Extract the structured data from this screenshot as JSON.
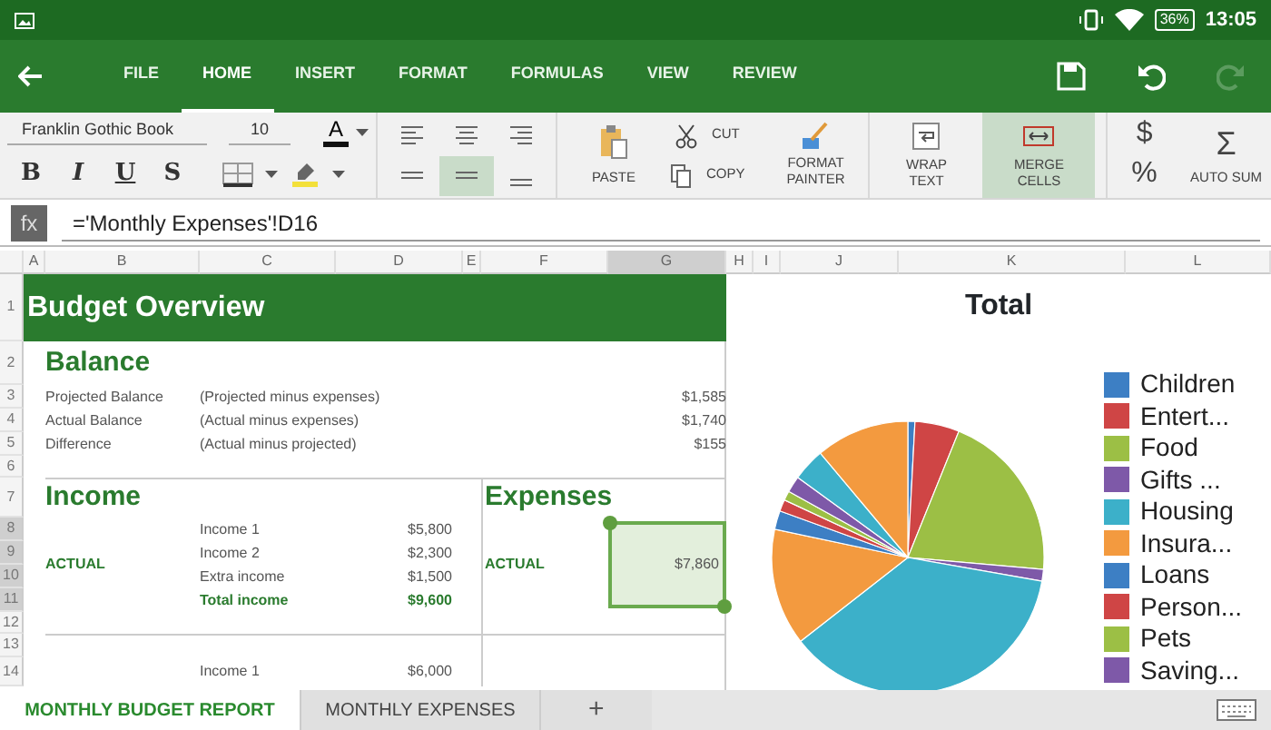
{
  "status_bar": {
    "battery": "36%",
    "time": "13:05"
  },
  "toolbar": {
    "tabs": [
      {
        "label": "FILE",
        "selected": false
      },
      {
        "label": "HOME",
        "selected": true
      },
      {
        "label": "INSERT",
        "selected": false
      },
      {
        "label": "FORMAT",
        "selected": false
      },
      {
        "label": "FORMULAS",
        "selected": false
      },
      {
        "label": "VIEW",
        "selected": false
      },
      {
        "label": "REVIEW",
        "selected": false
      }
    ],
    "redo_disabled": true
  },
  "ribbon": {
    "font_name": "Franklin Gothic Book",
    "font_size": "10",
    "font_color_letter": "A",
    "styles": [
      "B",
      "I",
      "U",
      "S"
    ],
    "alignments": [
      {
        "kind": "top-left",
        "selected": false
      },
      {
        "kind": "top-center",
        "selected": false
      },
      {
        "kind": "top-right",
        "selected": false
      },
      {
        "kind": "middle-left",
        "selected": false
      },
      {
        "kind": "middle-center",
        "selected": true
      },
      {
        "kind": "bottom",
        "selected": false
      }
    ],
    "paste": "PASTE",
    "cut": "CUT",
    "copy": "COPY",
    "format_painter": "FORMAT PAINTER",
    "wrap_text": {
      "label": "WRAP TEXT",
      "selected": false
    },
    "merge_cells": {
      "label": "MERGE CELLS",
      "selected": true
    },
    "currency": "$",
    "percent": "%",
    "auto_sum": {
      "symbol": "Σ",
      "label": "AUTO SUM"
    }
  },
  "formula_bar": {
    "label": "fx",
    "value": "='Monthly Expenses'!D16"
  },
  "sheet": {
    "columns": [
      {
        "label": "A",
        "selected": false
      },
      {
        "label": "B",
        "selected": false
      },
      {
        "label": "C",
        "selected": false
      },
      {
        "label": "D",
        "selected": false
      },
      {
        "label": "E",
        "selected": false
      },
      {
        "label": "F",
        "selected": false
      },
      {
        "label": "G",
        "selected": true
      },
      {
        "label": "H",
        "selected": false
      },
      {
        "label": "I",
        "selected": false
      },
      {
        "label": "J",
        "selected": false
      },
      {
        "label": "K",
        "selected": false
      },
      {
        "label": "L",
        "selected": false
      }
    ],
    "rows": [
      {
        "label": "1",
        "selected": false
      },
      {
        "label": "2",
        "selected": false
      },
      {
        "label": "3",
        "selected": false
      },
      {
        "label": "4",
        "selected": false
      },
      {
        "label": "5",
        "selected": false
      },
      {
        "label": "6",
        "selected": false
      },
      {
        "label": "7",
        "selected": false
      },
      {
        "label": "8",
        "selected": true
      },
      {
        "label": "9",
        "selected": true
      },
      {
        "label": "10",
        "selected": true
      },
      {
        "label": "11",
        "selected": true
      },
      {
        "label": "12",
        "selected": false
      },
      {
        "label": "13",
        "selected": false
      },
      {
        "label": "14",
        "selected": false
      }
    ],
    "title": "Budget Overview",
    "balance": {
      "heading": "Balance",
      "rows": [
        {
          "label": "Projected Balance",
          "note": "(Projected  minus expenses)",
          "value": "$1,585"
        },
        {
          "label": "Actual Balance",
          "note": "(Actual  minus expenses)",
          "value": "$1,740"
        },
        {
          "label": "Difference",
          "note": "(Actual minus projected)",
          "value": "$155"
        }
      ]
    },
    "income": {
      "heading": "Income",
      "tag": "ACTUAL",
      "items": [
        {
          "label": "Income 1",
          "value": "$5,800",
          "total": false
        },
        {
          "label": "Income 2",
          "value": "$2,300",
          "total": false
        },
        {
          "label": "Extra income",
          "value": "$1,500",
          "total": false
        },
        {
          "label": "Total income",
          "value": "$9,600",
          "total": true
        }
      ],
      "next_item": {
        "label": "Income 1",
        "value": "$6,000"
      }
    },
    "expenses": {
      "heading": "Expenses",
      "tag": "ACTUAL",
      "value": "$7,860",
      "selected": true
    }
  },
  "chart": {
    "title": "Total",
    "legend": [
      {
        "label": "Children",
        "color": "#3d7fc4"
      },
      {
        "label": "Entert...",
        "color": "#cf4545"
      },
      {
        "label": "Food",
        "color": "#9cbf45"
      },
      {
        "label": "Gifts ...",
        "color": "#7e59a8"
      },
      {
        "label": "Housing",
        "color": "#3cb0c9"
      },
      {
        "label": "Insura...",
        "color": "#f39a3f"
      },
      {
        "label": "Loans",
        "color": "#3d7fc4"
      },
      {
        "label": "Person...",
        "color": "#cf4545"
      },
      {
        "label": "Pets",
        "color": "#9cbf45"
      },
      {
        "label": "Saving...",
        "color": "#7e59a8"
      }
    ]
  },
  "sheet_tabs": [
    {
      "label": "MONTHLY BUDGET REPORT",
      "selected": true
    },
    {
      "label": "MONTHLY EXPENSES",
      "selected": false
    }
  ],
  "add_sheet": "+"
}
